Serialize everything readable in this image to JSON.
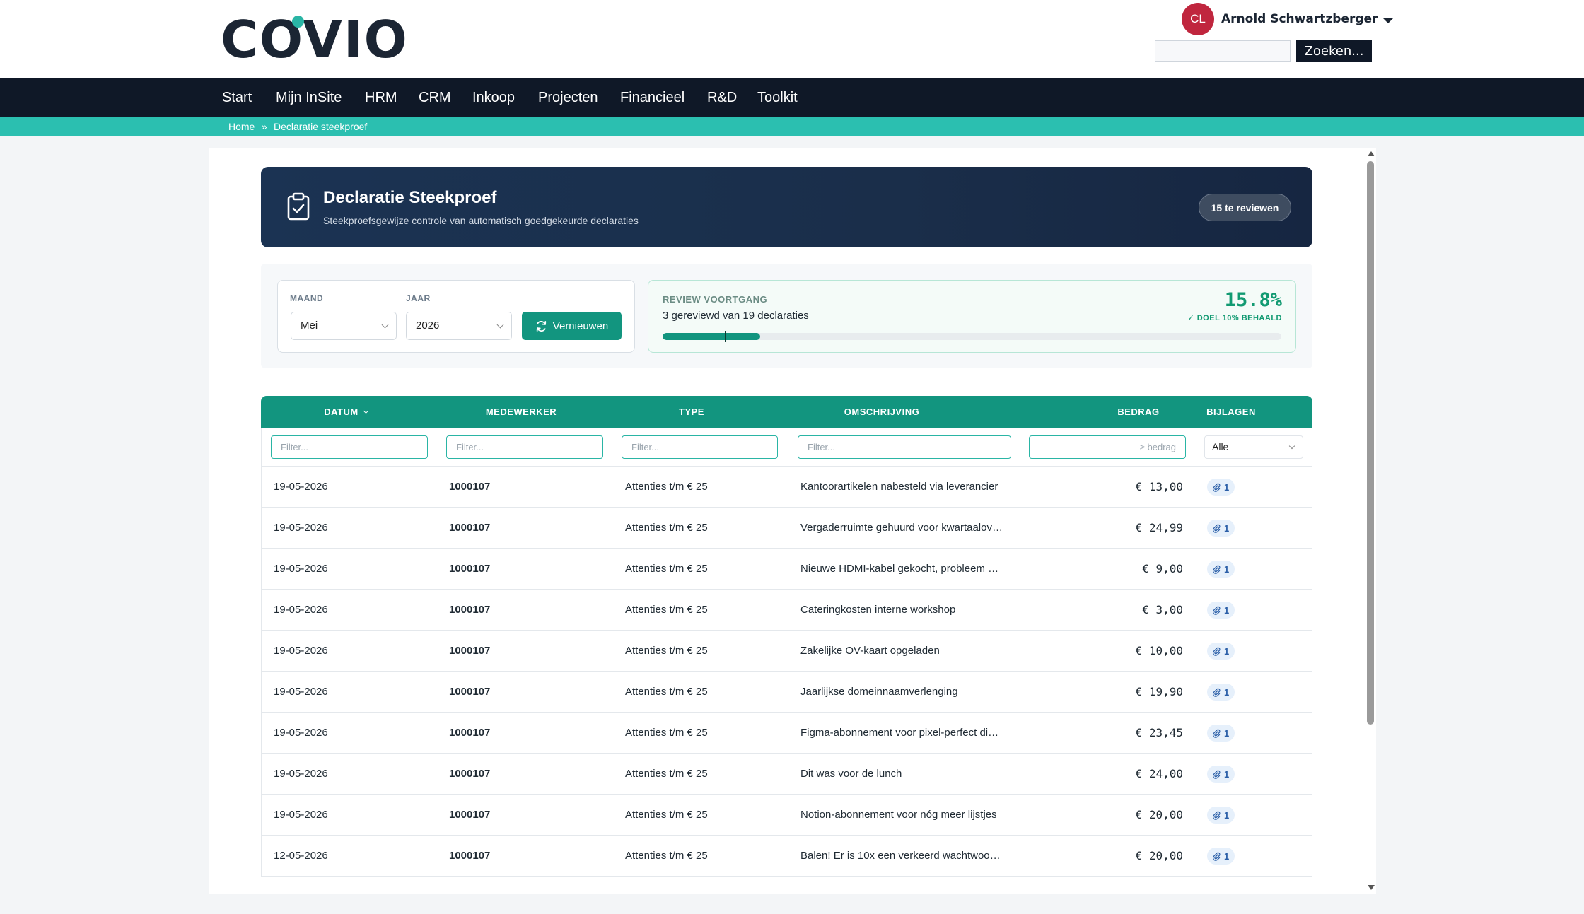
{
  "header": {
    "logo_text": "COVIO",
    "user_initials": "CL",
    "user_name": "Arnold Schwartzberger",
    "search_placeholder": "",
    "search_button": "Zoeken..."
  },
  "nav": {
    "items": [
      "Start",
      "Mijn InSite",
      "HRM",
      "CRM",
      "Inkoop",
      "Projecten",
      "Financieel",
      "R&D",
      "Toolkit"
    ]
  },
  "breadcrumb": {
    "home": "Home",
    "separator": "»",
    "current": "Declaratie steekproef"
  },
  "hero": {
    "title": "Declaratie Steekproef",
    "subtitle": "Steekproefsgewijze controle van automatisch goedgekeurde declaraties",
    "badge": "15 te reviewen"
  },
  "filters": {
    "month_label": "MAAND",
    "month_value": "Mei",
    "year_label": "JAAR",
    "year_value": "2026",
    "refresh_label": "Vernieuwen"
  },
  "progress": {
    "label": "REVIEW VOORTGANG",
    "text": "3 gereviewd van 19 declaraties",
    "percent_text": "15.8%",
    "goal_text": "✓ DOEL 10% BEHAALD",
    "fraction": 0.158,
    "goal_fraction": 0.1
  },
  "table": {
    "columns": [
      "DATUM",
      "MEDEWERKER",
      "TYPE",
      "OMSCHRIJVING",
      "BEDRAG",
      "BIJLAGEN"
    ],
    "filter_placeholder": "Filter...",
    "amount_placeholder": "≥ bedrag",
    "attachments_filter": "Alle",
    "rows": [
      {
        "date": "19-05-2026",
        "employee": "1000107",
        "type": "Attenties t/m € 25",
        "description": "Kantoorartikelen nabesteld via leverancier",
        "amount": "€ 13,00",
        "attachments": "1"
      },
      {
        "date": "19-05-2026",
        "employee": "1000107",
        "type": "Attenties t/m € 25",
        "description": "Vergaderruimte gehuurd voor kwartaalov…",
        "amount": "€ 24,99",
        "attachments": "1"
      },
      {
        "date": "19-05-2026",
        "employee": "1000107",
        "type": "Attenties t/m € 25",
        "description": "Nieuwe HDMI-kabel gekocht, probleem …",
        "amount": "€ 9,00",
        "attachments": "1"
      },
      {
        "date": "19-05-2026",
        "employee": "1000107",
        "type": "Attenties t/m € 25",
        "description": "Cateringkosten interne workshop",
        "amount": "€ 3,00",
        "attachments": "1"
      },
      {
        "date": "19-05-2026",
        "employee": "1000107",
        "type": "Attenties t/m € 25",
        "description": "Zakelijke OV-kaart opgeladen",
        "amount": "€ 10,00",
        "attachments": "1"
      },
      {
        "date": "19-05-2026",
        "employee": "1000107",
        "type": "Attenties t/m € 25",
        "description": "Jaarlijkse domeinnaamverlenging",
        "amount": "€ 19,90",
        "attachments": "1"
      },
      {
        "date": "19-05-2026",
        "employee": "1000107",
        "type": "Attenties t/m € 25",
        "description": "Figma-abonnement voor pixel-perfect di…",
        "amount": "€ 23,45",
        "attachments": "1"
      },
      {
        "date": "19-05-2026",
        "employee": "1000107",
        "type": "Attenties t/m € 25",
        "description": "Dit was voor de lunch",
        "amount": "€ 24,00",
        "attachments": "1"
      },
      {
        "date": "19-05-2026",
        "employee": "1000107",
        "type": "Attenties t/m € 25",
        "description": "Notion-abonnement voor nóg meer lijstjes",
        "amount": "€ 20,00",
        "attachments": "1"
      },
      {
        "date": "12-05-2026",
        "employee": "1000107",
        "type": "Attenties t/m € 25",
        "description": "Balen! Er is 10x een verkeerd wachtwoo…",
        "amount": "€ 20,00",
        "attachments": "1"
      }
    ]
  },
  "colors": {
    "accent": "#12957f",
    "nav_bg": "#0f1827",
    "breadcrumb_bg": "#2bbfb0",
    "avatar_bg": "#c0263e"
  }
}
